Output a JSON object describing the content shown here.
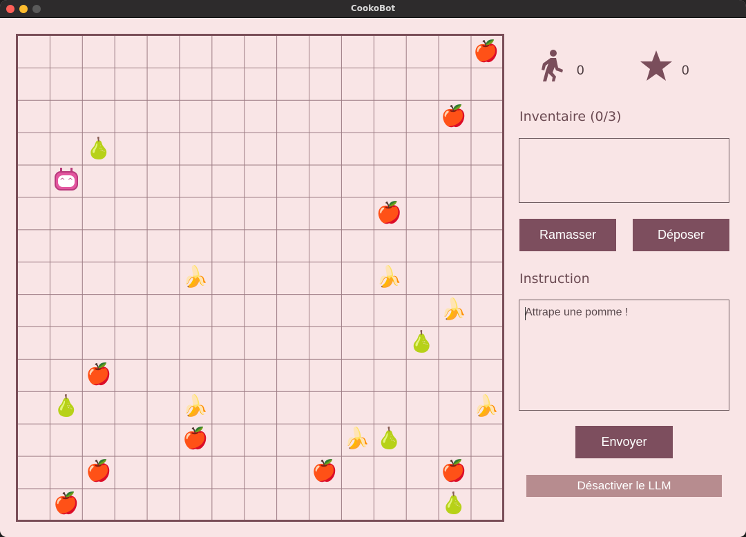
{
  "window": {
    "title": "CookoBot"
  },
  "stats": {
    "steps_icon": "walking-person-icon",
    "steps": "0",
    "score_icon": "star-icon",
    "score": "0"
  },
  "inventory": {
    "label": "Inventaire (0/3)",
    "items": []
  },
  "actions": {
    "pickup_label": "Ramasser",
    "drop_label": "Déposer"
  },
  "instruction": {
    "label": "Instruction",
    "value": "Attrape une pomme !"
  },
  "send_label": "Envoyer",
  "llm_toggle_label": "Désactiver le LLM",
  "board": {
    "rows": 15,
    "cols": 15,
    "robot": {
      "row": 4,
      "col": 1
    },
    "items": [
      {
        "type": "apple",
        "row": 0,
        "col": 14
      },
      {
        "type": "apple",
        "row": 2,
        "col": 13
      },
      {
        "type": "pear",
        "row": 3,
        "col": 2
      },
      {
        "type": "apple",
        "row": 5,
        "col": 11
      },
      {
        "type": "banana",
        "row": 7,
        "col": 5
      },
      {
        "type": "banana",
        "row": 7,
        "col": 11
      },
      {
        "type": "banana",
        "row": 8,
        "col": 13
      },
      {
        "type": "pear",
        "row": 9,
        "col": 12
      },
      {
        "type": "apple",
        "row": 10,
        "col": 2
      },
      {
        "type": "pear",
        "row": 11,
        "col": 1
      },
      {
        "type": "banana",
        "row": 11,
        "col": 5
      },
      {
        "type": "banana",
        "row": 11,
        "col": 14
      },
      {
        "type": "apple",
        "row": 12,
        "col": 5
      },
      {
        "type": "banana",
        "row": 12,
        "col": 10
      },
      {
        "type": "pear",
        "row": 12,
        "col": 11
      },
      {
        "type": "apple",
        "row": 13,
        "col": 2
      },
      {
        "type": "apple",
        "row": 13,
        "col": 9
      },
      {
        "type": "apple",
        "row": 13,
        "col": 13
      },
      {
        "type": "apple",
        "row": 14,
        "col": 1
      },
      {
        "type": "pear",
        "row": 14,
        "col": 13
      }
    ]
  }
}
